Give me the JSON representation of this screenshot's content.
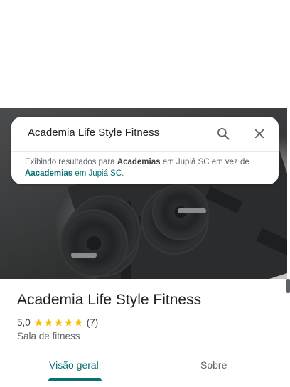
{
  "search": {
    "query": "Academia Life Style Fitness",
    "notice_prefix": "Exibindo resultados para ",
    "notice_term": "Academias",
    "notice_middle": " em Jupiá SC em vez de ",
    "notice_link_term": "Aacademias",
    "notice_link_rest": " em Jupiá SC",
    "notice_suffix": "."
  },
  "place": {
    "name": "Academia Life Style Fitness",
    "rating": "5,0",
    "stars": 5,
    "review_count": "(7)",
    "category": "Sala de fitness"
  },
  "tabs": [
    {
      "label": "Visão geral",
      "active": true
    },
    {
      "label": "Sobre",
      "active": false
    }
  ],
  "icons": {
    "search": "search-icon",
    "close": "close-icon",
    "star": "star-icon"
  },
  "colors": {
    "accent": "#0b7075",
    "star": "#fbbc04",
    "text_primary": "#202124",
    "text_secondary": "#5f6368"
  }
}
